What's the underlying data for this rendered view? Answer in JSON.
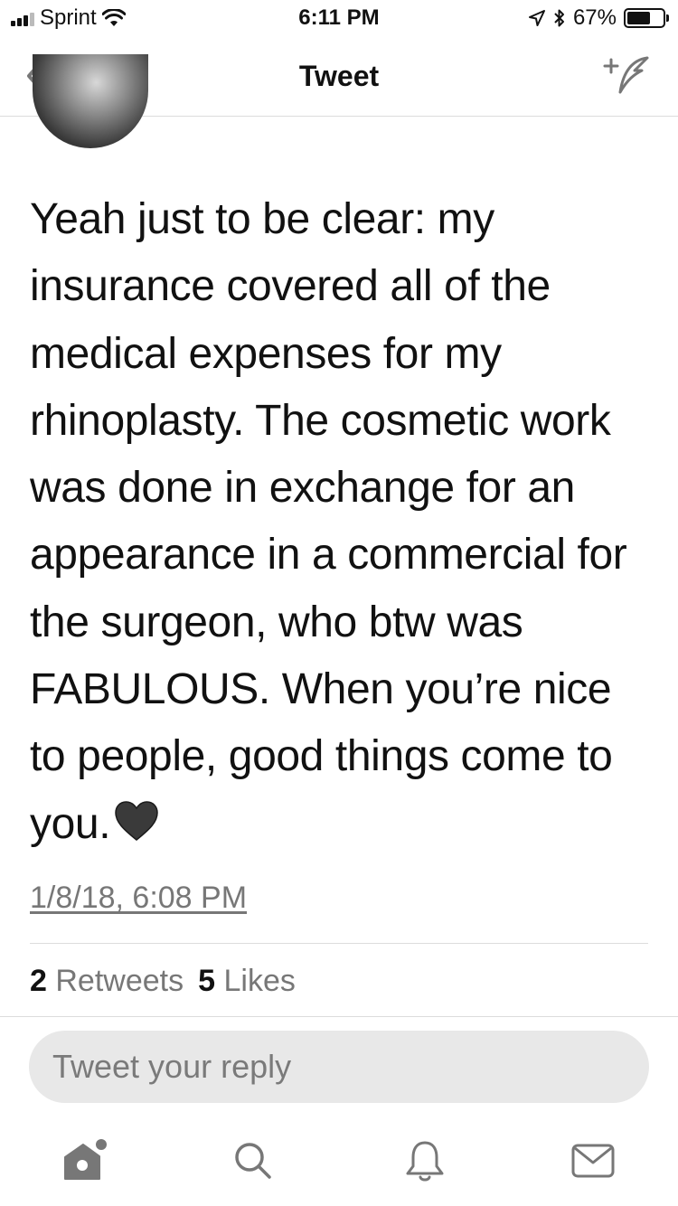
{
  "status_bar": {
    "carrier": "Sprint",
    "time": "6:11 PM",
    "battery_percent": "67%",
    "battery_level": 0.67,
    "icons": [
      "signal-icon",
      "wifi-icon",
      "location-icon",
      "bluetooth-icon",
      "battery-icon"
    ]
  },
  "nav": {
    "title": "Tweet",
    "back_icon": "chevron-left-icon",
    "compose_icon": "compose-tweet-icon"
  },
  "tweet": {
    "text": "Yeah just to be clear: my insurance covered all of the medical expenses for my rhinoplasty. The cosmetic work was done in exchange for an appearance in a commercial for the surgeon, who btw was FABULOUS. When you’re nice to people, good things come to you.",
    "emoji": "black-heart-emoji",
    "timestamp": "1/8/18, 6:08 PM",
    "stats": {
      "retweets_count": "2",
      "retweets_label": "Retweets",
      "likes_count": "5",
      "likes_label": "Likes"
    }
  },
  "reply": {
    "placeholder": "Tweet your reply"
  },
  "tab_bar": {
    "tabs": [
      {
        "name": "home",
        "icon": "home-icon"
      },
      {
        "name": "search",
        "icon": "search-icon"
      },
      {
        "name": "notifications",
        "icon": "bell-icon"
      },
      {
        "name": "messages",
        "icon": "mail-icon"
      }
    ]
  },
  "colors": {
    "text": "#111111",
    "muted": "#777777",
    "divider": "#dcdcdc",
    "reply_bg": "#e8e8e8"
  }
}
